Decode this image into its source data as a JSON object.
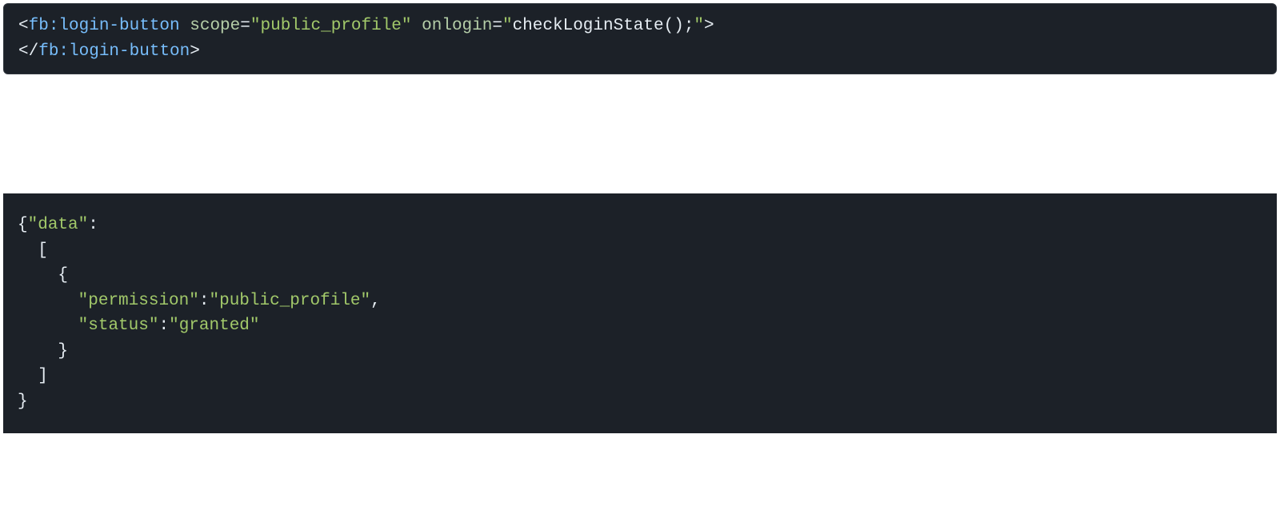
{
  "block1": {
    "l1": {
      "open_lt": "<",
      "tag1": "fb:login-button",
      "sp1": " ",
      "attr1_name": "scope",
      "eq1": "=",
      "attr1_q_open": "\"",
      "attr1_val": "public_profile",
      "attr1_q_close": "\"",
      "sp2": " ",
      "attr2_name": "onlogin",
      "eq2": "=",
      "attr2_q_open": "\"",
      "attr2_val": "checkLoginState();",
      "attr2_q_close": "\"",
      "open_gt": ">"
    },
    "l2": {
      "close_lt": "</",
      "tag": "fb:login-button",
      "close_gt": ">"
    }
  },
  "block2": {
    "l1_open": "{",
    "l1_q1": "\"",
    "l1_key": "data",
    "l1_q2": "\"",
    "l1_colon": ":",
    "l2_indent": "  ",
    "l2_open": "[",
    "l3_indent": "    ",
    "l3_open": "{",
    "l4_indent": "      ",
    "l4_q1": "\"",
    "l4_key": "permission",
    "l4_q2": "\"",
    "l4_colon": ":",
    "l4_q3": "\"",
    "l4_val": "public_profile",
    "l4_q4": "\"",
    "l4_comma": ",",
    "l5_indent": "      ",
    "l5_q1": "\"",
    "l5_key": "status",
    "l5_q2": "\"",
    "l5_colon": ":",
    "l5_q3": "\"",
    "l5_val": "granted",
    "l5_q4": "\"",
    "l6_indent": "    ",
    "l6_close": "}",
    "l7_indent": "  ",
    "l7_close": "]",
    "l8_close": "}"
  }
}
